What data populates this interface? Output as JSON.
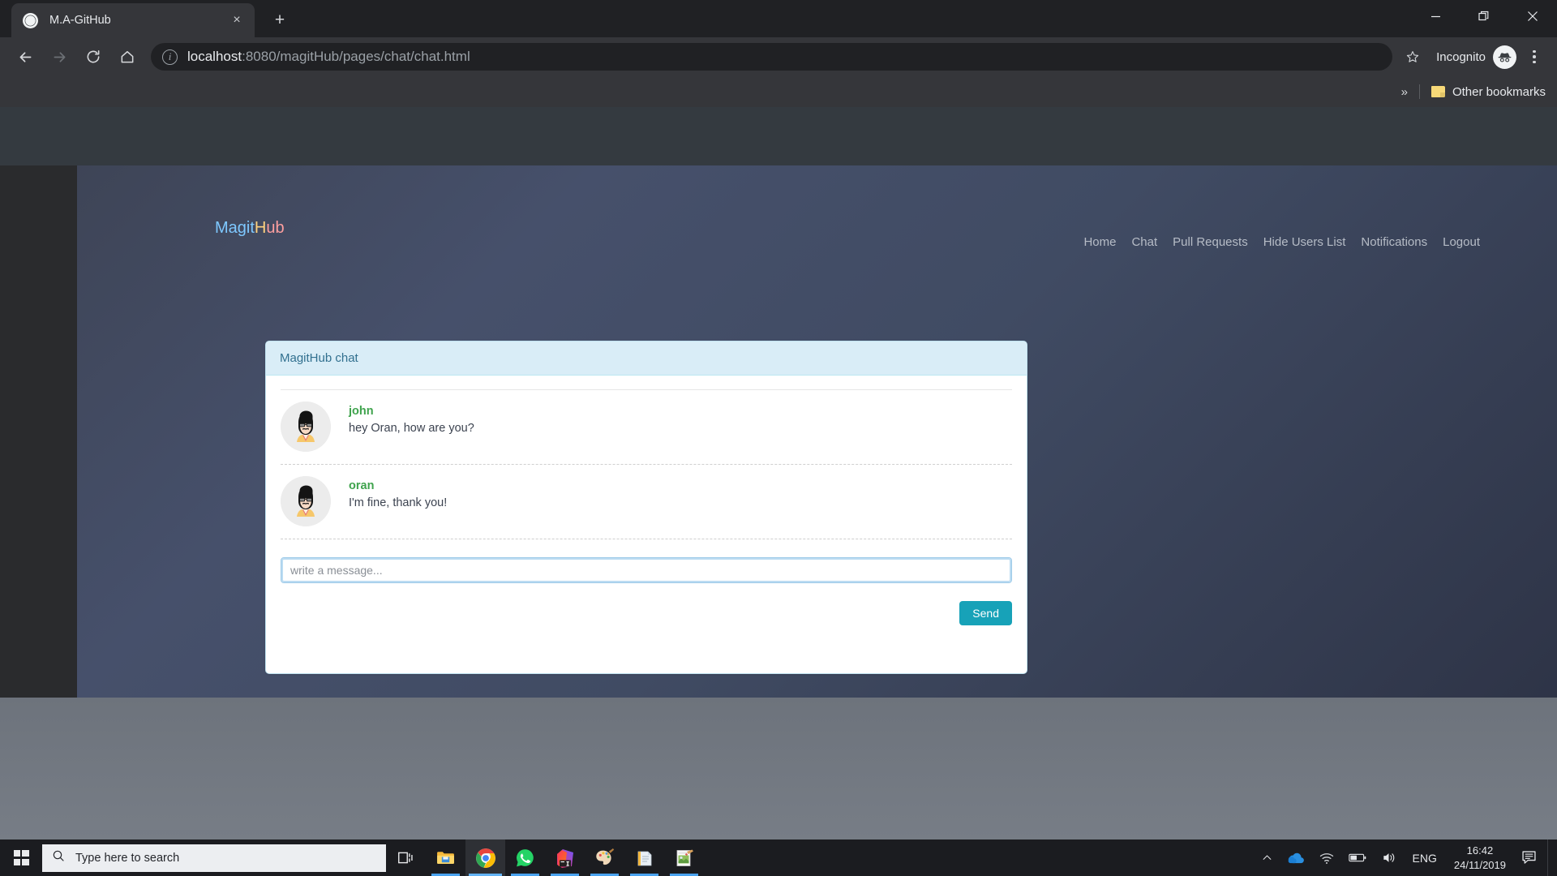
{
  "browser": {
    "tab": {
      "title": "M.A-GitHub",
      "favicon_icon": "globe-icon",
      "close_icon": "×"
    },
    "new_tab_label": "+",
    "window_controls": {
      "minimize": "—",
      "maximize": "❐",
      "close": "✕"
    },
    "nav": {
      "back_icon": "←",
      "forward_icon": "→",
      "reload_icon": "⟳",
      "home_icon": "⌂"
    },
    "omnibox": {
      "info_icon": "ⓘ",
      "url_host": "localhost",
      "url_rest": ":8080/magitHub/pages/chat/chat.html",
      "full_url": "localhost:8080/magitHub/pages/chat/chat.html",
      "star_icon": "☆"
    },
    "profile": {
      "label": "Incognito",
      "badge_icon": "incognito-hat-icon"
    },
    "menu_icon": "kebab-menu-icon",
    "bookmarks": {
      "overflow_icon": "»",
      "folder_label": "Other bookmarks"
    }
  },
  "site": {
    "brand": {
      "part1": "Magit",
      "part2": "H",
      "part3": "ub",
      "full": "MagitHub"
    },
    "nav_items": [
      {
        "label": "Home"
      },
      {
        "label": "Chat"
      },
      {
        "label": "Pull Requests"
      },
      {
        "label": "Hide Users List"
      },
      {
        "label": "Notifications"
      },
      {
        "label": "Logout"
      }
    ]
  },
  "chat_panel": {
    "header_title": "MagitHub chat",
    "messages": [
      {
        "user": "john",
        "text": "hey Oran, how are you?",
        "avatar_icon": "bearded-man-avatar"
      },
      {
        "user": "oran",
        "text": "I'm fine, thank you!",
        "avatar_icon": "bearded-man-avatar"
      }
    ],
    "input_placeholder": "write a message...",
    "input_value": "",
    "send_label": "Send"
  },
  "taskbar": {
    "start_icon": "windows-logo-icon",
    "search_placeholder": "Type here to search",
    "search_icon": "search-icon",
    "apps": [
      {
        "name": "task-view-icon",
        "label": "Task View"
      },
      {
        "name": "file-explorer-icon",
        "label": "File Explorer"
      },
      {
        "name": "google-chrome-icon",
        "label": "Google Chrome"
      },
      {
        "name": "whatsapp-icon",
        "label": "WhatsApp"
      },
      {
        "name": "intellij-idea-icon",
        "label": "IntelliJ IDEA"
      },
      {
        "name": "paint-icon",
        "label": "Paint"
      },
      {
        "name": "notepad-icon",
        "label": "Notepad"
      },
      {
        "name": "paint3d-icon",
        "label": "Paint 3D"
      }
    ],
    "tray": {
      "chevron_icon": "chevron-up-icon",
      "onedrive_icon": "onedrive-cloud-icon",
      "wifi_icon": "wifi-icon",
      "battery_icon": "battery-icon",
      "volume_icon": "volume-icon",
      "language": "ENG",
      "time": "16:42",
      "date": "24/11/2019",
      "notifications_icon": "action-center-icon"
    }
  },
  "colors": {
    "accent_teal": "#17a2b8",
    "panel_header_bg": "#d9edf7",
    "panel_header_text": "#31708f",
    "username_green": "#3fa34d",
    "topbar_dark": "#343a40"
  }
}
